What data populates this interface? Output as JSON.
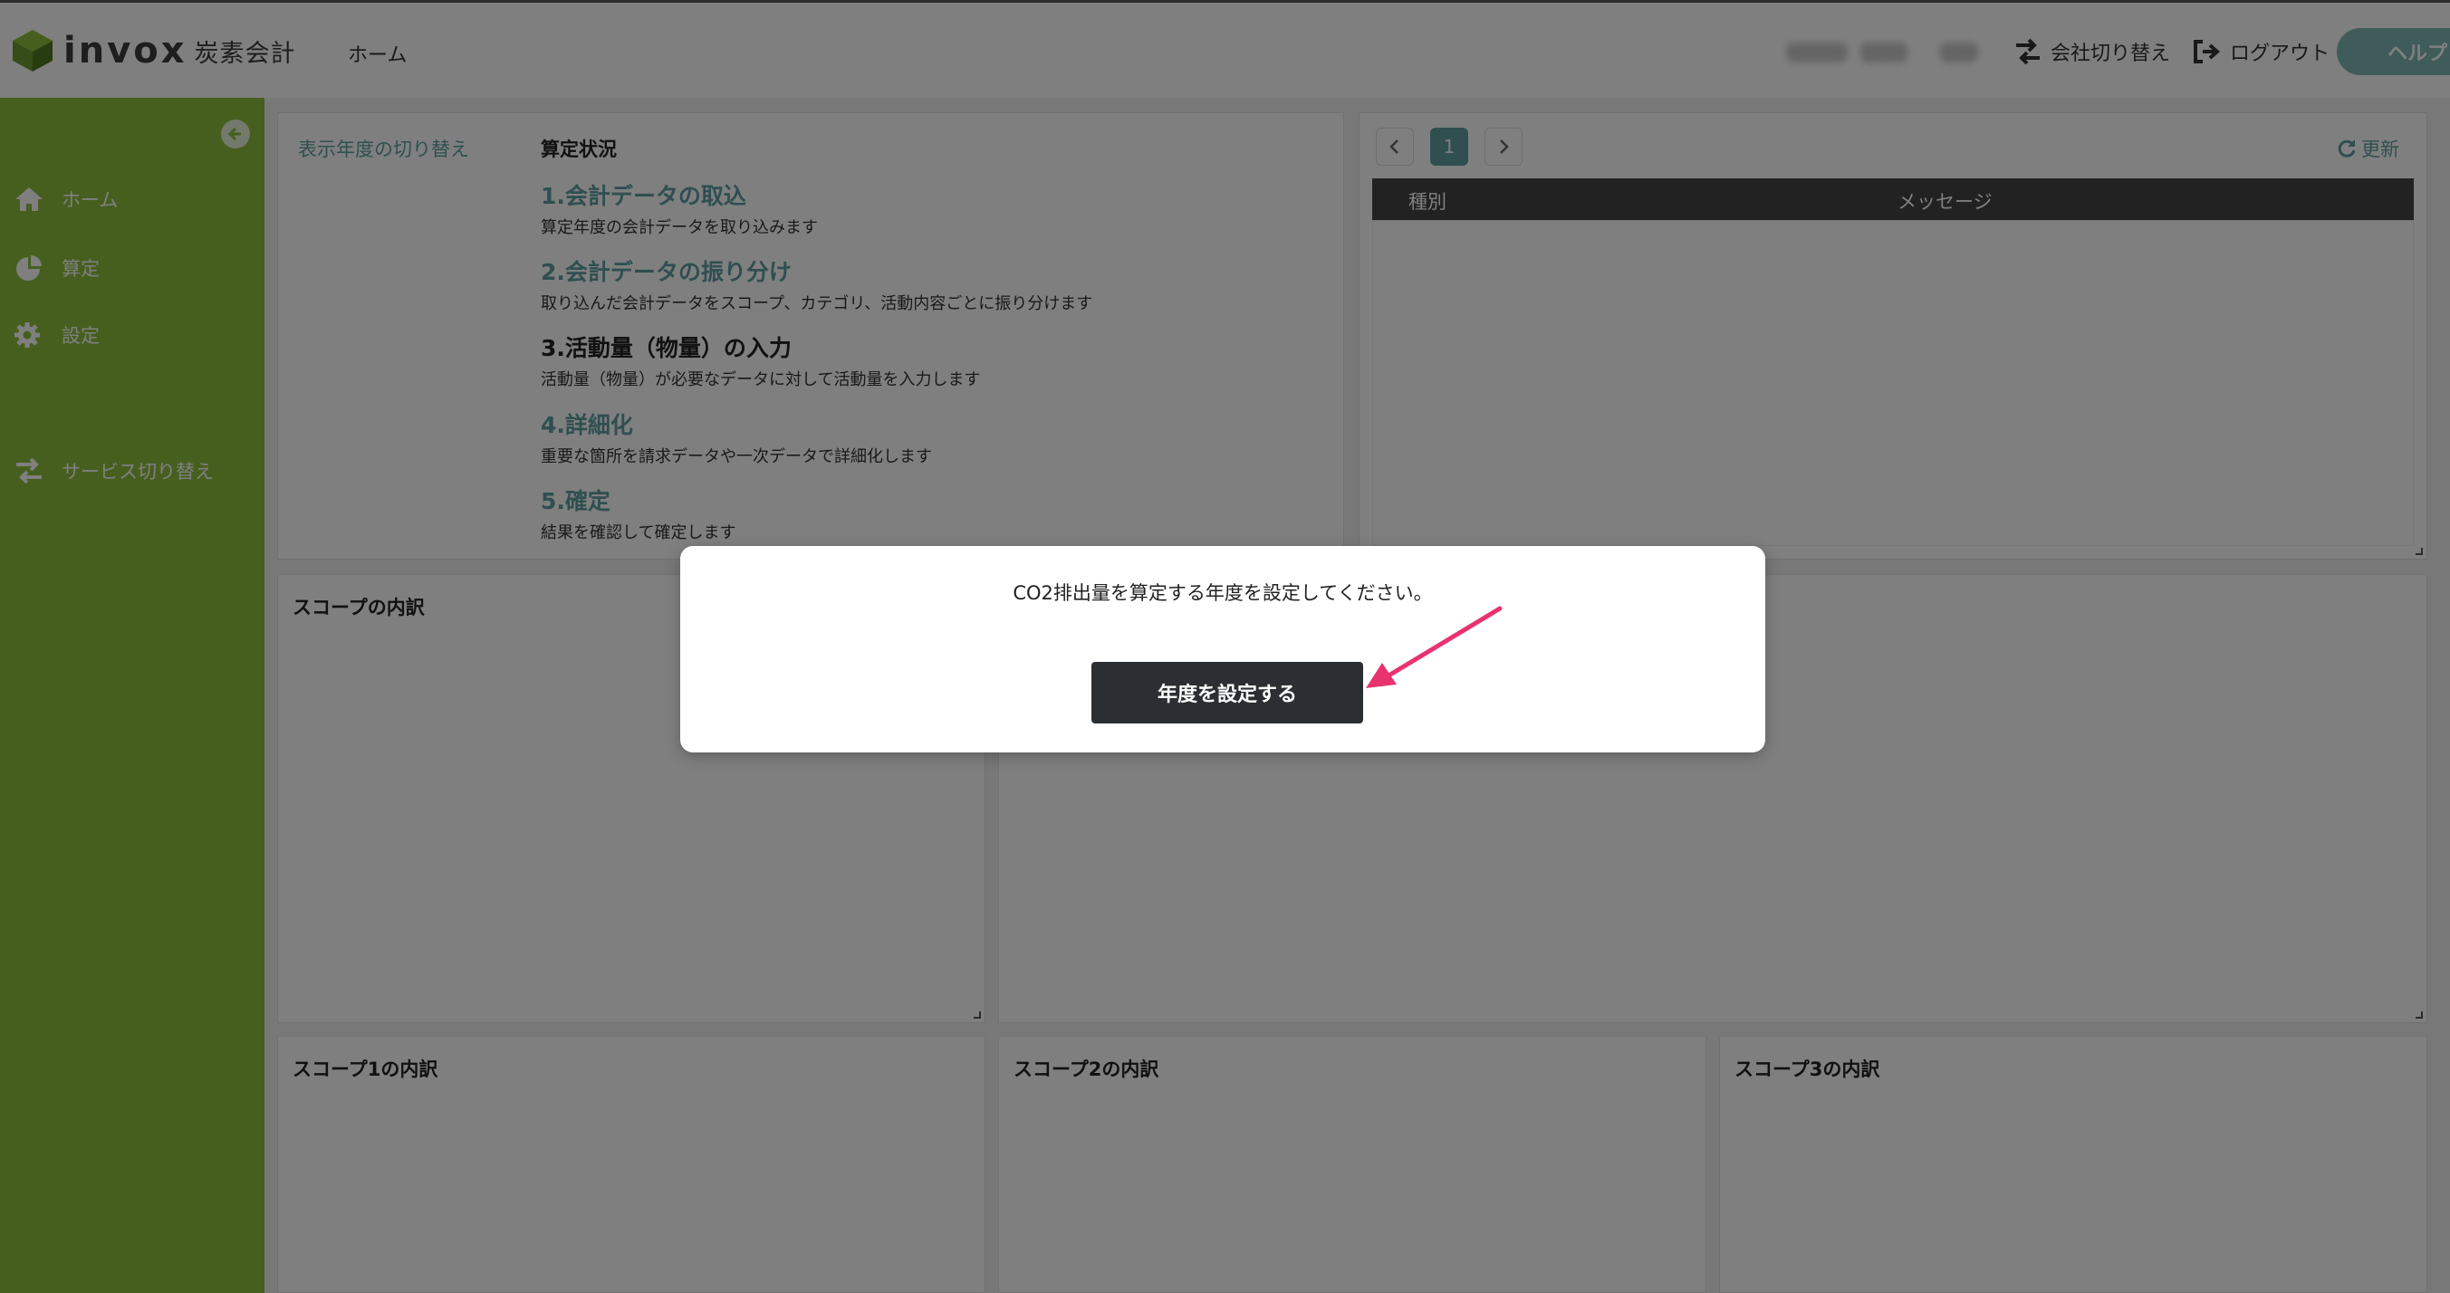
{
  "header": {
    "logo_text": "invox",
    "logo_sub": "炭素会計",
    "nav_home": "ホーム",
    "company_switch": "会社切り替え",
    "logout": "ログアウト",
    "help": "ヘルプ"
  },
  "sidebar": {
    "items": [
      {
        "label": "ホーム",
        "icon": "home-icon"
      },
      {
        "label": "算定",
        "icon": "pie-chart-icon"
      },
      {
        "label": "設定",
        "icon": "gear-icon"
      },
      {
        "label": "サービス切り替え",
        "icon": "exchange-icon"
      }
    ]
  },
  "status_panel": {
    "year_switch": "表示年度の切り替え",
    "title": "算定状況",
    "steps": [
      {
        "title": "1.会計データの取込",
        "desc": "算定年度の会計データを取り込みます"
      },
      {
        "title": "2.会計データの振り分け",
        "desc": "取り込んだ会計データをスコープ、カテゴリ、活動内容ごとに振り分けます"
      },
      {
        "title": "3.活動量（物量）の入力",
        "desc": "活動量（物量）が必要なデータに対して活動量を入力します"
      },
      {
        "title": "4.詳細化",
        "desc": "重要な箇所を請求データや一次データで詳細化します"
      },
      {
        "title": "5.確定",
        "desc": "結果を確認して確定します"
      }
    ]
  },
  "messages_panel": {
    "page": "1",
    "refresh": "更新",
    "col_type": "種別",
    "col_message": "メッセージ"
  },
  "panels": {
    "scope_breakdown": "スコープの内訳",
    "scope1": "スコープ1の内訳",
    "scope2": "スコープ2の内訳",
    "scope3": "スコープ3の内訳"
  },
  "modal": {
    "message": "CO2排出量を算定する年度を設定してください。",
    "button": "年度を設定する"
  },
  "colors": {
    "sidebar": "#8dbf3f",
    "accent": "#5f9ea0",
    "button_dark": "#2b2f33",
    "arrow": "#e8336e"
  }
}
